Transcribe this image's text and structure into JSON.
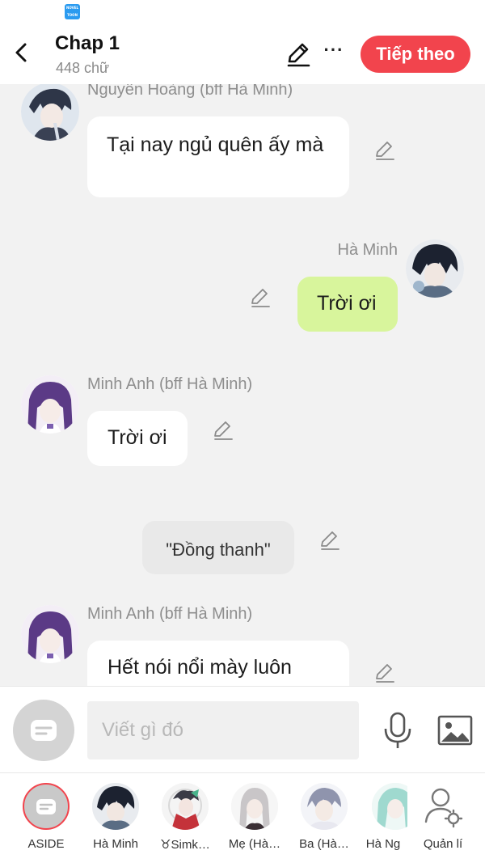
{
  "status": {
    "app_icon_text": "NOVEL TOON"
  },
  "header": {
    "title": "Chap 1",
    "subtitle": "448 chữ",
    "next_label": "Tiếp theo",
    "more_label": "···"
  },
  "messages": [
    {
      "speaker": "Nguyên Hoàng (bff Hà Minh)",
      "text": "Tại nay ngủ quên ấy mà",
      "side": "left"
    },
    {
      "speaker": "Hà Minh",
      "text": "Trời ơi",
      "side": "right"
    },
    {
      "speaker": "Minh Anh (bff Hà Minh)",
      "text": "Trời ơi",
      "side": "left"
    },
    {
      "speaker": "",
      "text": "\"Đồng thanh\"",
      "side": "aside"
    },
    {
      "speaker": "Minh Anh (bff Hà Minh)",
      "text": "Hết nói nổi mày luôn",
      "side": "left"
    }
  ],
  "composer": {
    "placeholder": "Viết gì đó"
  },
  "characters": [
    {
      "name": "ASIDE"
    },
    {
      "name": "Hà Minh"
    },
    {
      "name": "♉Simk…"
    },
    {
      "name": "Mẹ (Hà…"
    },
    {
      "name": "Ba (Hà…"
    },
    {
      "name": "Hà Ng"
    },
    {
      "name": "Quản lí"
    }
  ],
  "colors": {
    "accent": "#f2444d",
    "my_bubble": "#d8f59c",
    "bubble": "#ffffff",
    "aside_bubble": "#e9e9e9",
    "background": "#f2f2f2"
  },
  "icons": [
    "back-arrow-icon",
    "pencil-icon",
    "more-icon",
    "chat-bubble-icon",
    "microphone-icon",
    "image-icon",
    "user-settings-icon"
  ]
}
